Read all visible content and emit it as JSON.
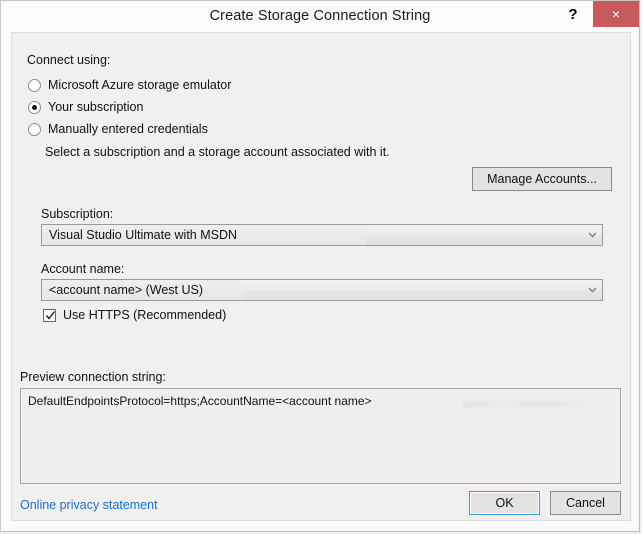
{
  "window": {
    "title": "Create Storage Connection String",
    "help_icon": "?",
    "close_icon": "×"
  },
  "connect_using": {
    "label": "Connect using:",
    "options": [
      {
        "label": "Microsoft Azure storage emulator",
        "selected": false
      },
      {
        "label": "Your subscription",
        "selected": true
      },
      {
        "label": "Manually entered credentials",
        "selected": false
      }
    ]
  },
  "description": "Select a subscription and a storage account associated with it.",
  "manage_accounts_button": "Manage Accounts...",
  "subscription": {
    "label": "Subscription:",
    "value": "Visual Studio Ultimate with MSDN"
  },
  "account_name": {
    "label": "Account name:",
    "value": "<account name> (West US)"
  },
  "use_https": {
    "label": "Use HTTPS (Recommended)",
    "checked": true
  },
  "preview": {
    "label": "Preview connection string:",
    "value": "DefaultEndpointsProtocol=https;AccountName=<account name>"
  },
  "footer": {
    "privacy_link": "Online privacy statement",
    "ok_button": "OK",
    "cancel_button": "Cancel"
  },
  "colors": {
    "close_button": "#c75b5b",
    "link": "#1a6fd4",
    "default_button_border": "#3a9bdc",
    "window_background": "#f0f0f0",
    "titlebar_background": "#fbfbfb"
  }
}
